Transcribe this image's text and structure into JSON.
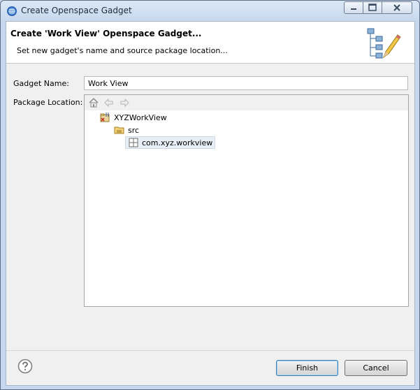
{
  "window": {
    "title": "Create Openspace Gadget",
    "controls": [
      "minimize-icon",
      "maximize-icon",
      "close-icon"
    ]
  },
  "banner": {
    "title": "Create 'Work View' Openspace Gadget...",
    "message": "Set new gadget's name and source package location...",
    "image": "wizard-pencil-icon"
  },
  "form": {
    "gadget_name_label": "Gadget Name:",
    "gadget_name_value": "Work View",
    "package_location_label": "Package Location:"
  },
  "tree": {
    "toolbar": [
      "home-icon",
      "back-icon",
      "forward-icon"
    ],
    "items": [
      {
        "label": "XYZWorkView",
        "icon": "java-project-icon",
        "level": 0
      },
      {
        "label": "src",
        "icon": "source-folder-icon",
        "level": 1
      },
      {
        "label": "com.xyz.workview",
        "icon": "package-icon",
        "level": 2,
        "selected": true
      }
    ]
  },
  "buttons": {
    "finish": "Finish",
    "cancel": "Cancel"
  }
}
